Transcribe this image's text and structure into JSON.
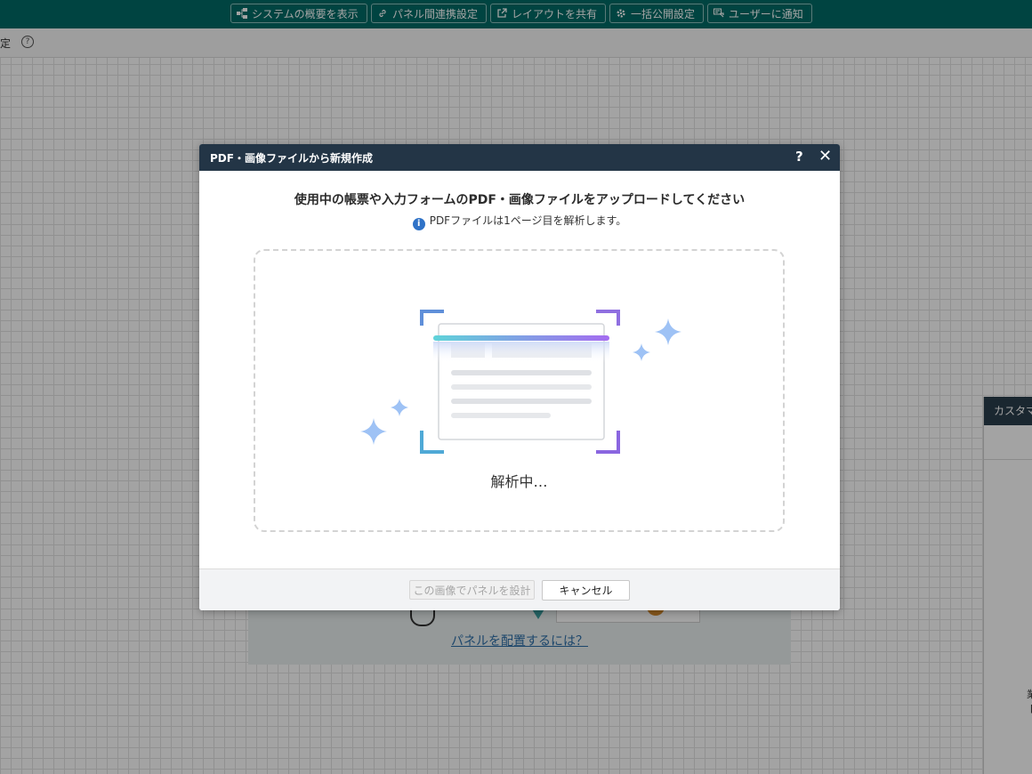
{
  "toolbar": {
    "buttons": [
      {
        "label": "システムの概要を表示",
        "icon": "sitemap-icon"
      },
      {
        "label": "パネル間連携設定",
        "icon": "link-icon"
      },
      {
        "label": "レイアウトを共有",
        "icon": "external-link-icon"
      },
      {
        "label": "一括公開設定",
        "icon": "gear-icon"
      },
      {
        "label": "ユーザーに通知",
        "icon": "notify-icon"
      }
    ]
  },
  "subbar": {
    "fix_label": "固定",
    "help_symbol": "?"
  },
  "background": {
    "link_text": "パネルを配置するには？",
    "side_panel_title": "カスタマ",
    "side_text_1": "業",
    "side_text_2": "["
  },
  "modal": {
    "title": "PDF・画像ファイルから新規作成",
    "help_symbol": "?",
    "close_symbol": "✕",
    "heading": "使用中の帳票や入力フォームのPDF・画像ファイルをアップロードしてください",
    "note_icon": "i",
    "note": "PDFファイルは1ページ目を解析します。",
    "status": "解析中…",
    "design_button_label": "この画像でパネルを設計",
    "cancel_button_label": "キャンセル"
  },
  "colors": {
    "toolbar_bg": "#006b66",
    "modal_header_bg": "#233546",
    "info_blue": "#2f72c7",
    "scan_gradient_start": "#5fd3d9",
    "scan_gradient_end": "#a46cf0",
    "sparkle": "#9ec2f5"
  }
}
